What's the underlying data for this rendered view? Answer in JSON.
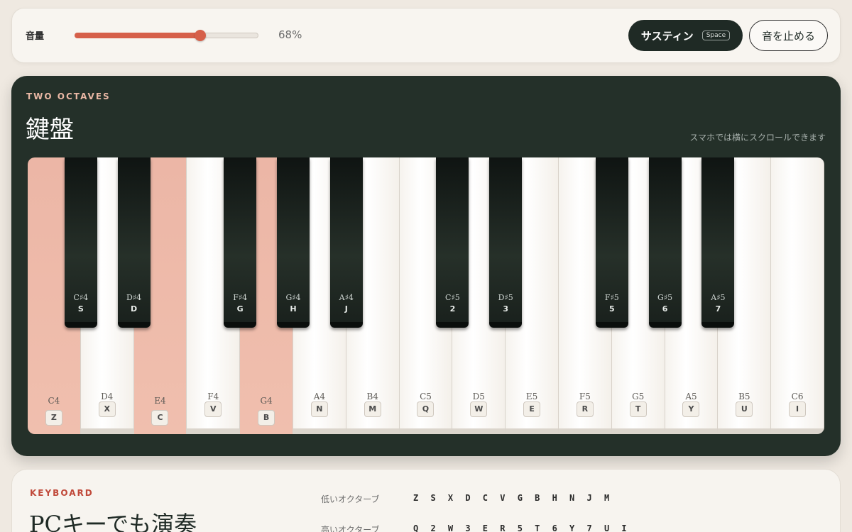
{
  "controls": {
    "volume_label": "音量",
    "volume_value": 68,
    "volume_text": "68%",
    "sustain_label": "サスティン",
    "sustain_key": "Space",
    "stop_label": "音を止める",
    "accent_color": "#d6604a"
  },
  "piano": {
    "eyebrow": "TWO OCTAVES",
    "title": "鍵盤",
    "scroll_hint": "スマホでは横にスクロールできます",
    "active_color": "#eeb9a8",
    "white_keys": [
      {
        "note": "C4",
        "key": "Z",
        "active": true
      },
      {
        "note": "D4",
        "key": "X",
        "active": false
      },
      {
        "note": "E4",
        "key": "C",
        "active": true
      },
      {
        "note": "F4",
        "key": "V",
        "active": false
      },
      {
        "note": "G4",
        "key": "B",
        "active": true
      },
      {
        "note": "A4",
        "key": "N",
        "active": false
      },
      {
        "note": "B4",
        "key": "M",
        "active": false
      },
      {
        "note": "C5",
        "key": "Q",
        "active": false
      },
      {
        "note": "D5",
        "key": "W",
        "active": false
      },
      {
        "note": "E5",
        "key": "E",
        "active": false
      },
      {
        "note": "F5",
        "key": "R",
        "active": false
      },
      {
        "note": "G5",
        "key": "T",
        "active": false
      },
      {
        "note": "A5",
        "key": "Y",
        "active": false
      },
      {
        "note": "B5",
        "key": "U",
        "active": false
      },
      {
        "note": "C6",
        "key": "I",
        "active": false
      }
    ],
    "black_keys": [
      {
        "note": "C♯4",
        "key": "S",
        "after": 0
      },
      {
        "note": "D♯4",
        "key": "D",
        "after": 1
      },
      {
        "note": "F♯4",
        "key": "G",
        "after": 3
      },
      {
        "note": "G♯4",
        "key": "H",
        "after": 4
      },
      {
        "note": "A♯4",
        "key": "J",
        "after": 5
      },
      {
        "note": "C♯5",
        "key": "2",
        "after": 7
      },
      {
        "note": "D♯5",
        "key": "3",
        "after": 8
      },
      {
        "note": "F♯5",
        "key": "5",
        "after": 10
      },
      {
        "note": "G♯5",
        "key": "6",
        "after": 11
      },
      {
        "note": "A♯5",
        "key": "7",
        "after": 12
      }
    ]
  },
  "keyboard_section": {
    "eyebrow": "KEYBOARD",
    "title": "PCキーでも演奏",
    "low_label": "低いオクターブ",
    "low_keys": "Z S X D C V G B H N J M",
    "high_label": "高いオクターブ",
    "high_keys": "Q 2 W 3 E R 5 T 6 Y 7 U I"
  }
}
